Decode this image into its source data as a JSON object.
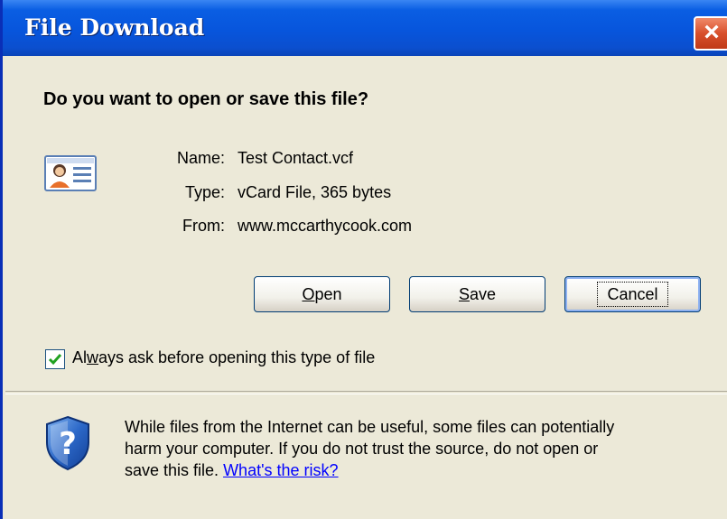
{
  "window": {
    "title": "File Download",
    "close_symbol": "×"
  },
  "dialog": {
    "question": "Do you want to open or save this file?",
    "file_icon": "vcard-icon",
    "name_label": "Name:",
    "name_value": "Test Contact.vcf",
    "type_label": "Type:",
    "type_value": "vCard File, 365 bytes",
    "from_label": "From:",
    "from_value": "www.mccarthycook.com"
  },
  "buttons": {
    "open_mnemonic": "O",
    "open_rest": "pen",
    "save_mnemonic": "S",
    "save_rest": "ave",
    "cancel": "Cancel"
  },
  "checkbox": {
    "checked": true,
    "label_pre": "Al",
    "label_mnemonic": "w",
    "label_post": "ays ask before opening this type of file"
  },
  "warning": {
    "icon": "shield-question-icon",
    "line1": "While files from the Internet can be useful, some files can potentially",
    "line2": "harm your computer. If you do not trust the source, do not open or",
    "line3_pre": "save this file.",
    "risk_link": "What's the risk?"
  },
  "colors": {
    "titlebar": "#0755dc",
    "dialog_bg": "#ece9d8",
    "close_button": "#d8502c",
    "link": "#0000ff"
  }
}
